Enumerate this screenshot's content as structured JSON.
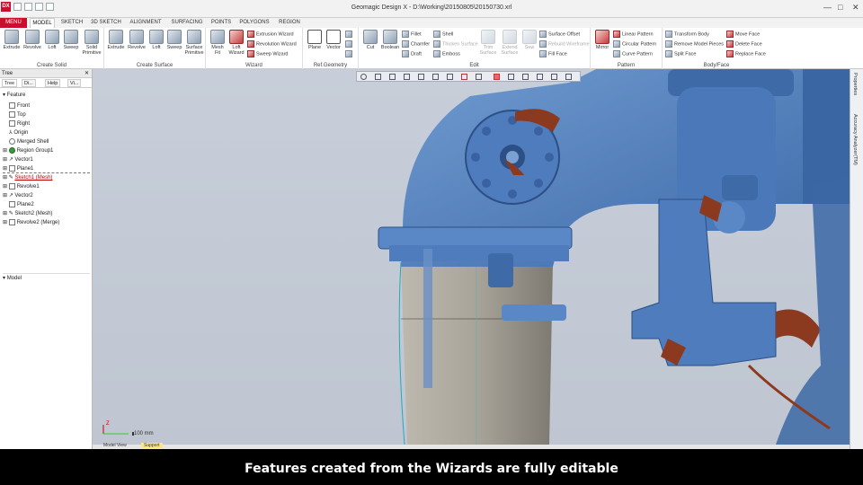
{
  "app": {
    "logo": "DX",
    "title": "Geomagic Design X - D:\\Working\\20150805\\20150730.xrl"
  },
  "window_controls": [
    "—",
    "□",
    "✕"
  ],
  "tabs": [
    {
      "label": "MENU"
    },
    {
      "label": "MODEL"
    },
    {
      "label": "SKETCH"
    },
    {
      "label": "3D SKETCH"
    },
    {
      "label": "ALIGNMENT"
    },
    {
      "label": "SURFACING"
    },
    {
      "label": "POINTS"
    },
    {
      "label": "POLYGONS"
    },
    {
      "label": "REGION"
    }
  ],
  "ribbon": {
    "create_solid": {
      "caption": "Create Solid",
      "buttons": [
        "Extrude",
        "Revolve",
        "Loft",
        "Sweep",
        "Solid Primitive"
      ]
    },
    "create_surface": {
      "caption": "Create Surface",
      "buttons": [
        "Extrude",
        "Revolve",
        "Loft",
        "Sweep",
        "Surface Primitive"
      ]
    },
    "wizard": {
      "caption": "Wizard",
      "buttons": [
        "Mesh Fit",
        "Loft Wizard"
      ],
      "small": [
        "Extrusion Wizard",
        "Revolution Wizard",
        "Sweep Wizard"
      ]
    },
    "ref_geometry": {
      "caption": "Ref.Geometry",
      "buttons": [
        "Plane",
        "Vector"
      ]
    },
    "edit": {
      "caption": "Edit",
      "buttons": [
        "Cut",
        "Boolean"
      ],
      "small": [
        "Fillet",
        "Chamfer",
        "Draft",
        "Shell",
        "Thicken Surface",
        "Emboss",
        "Trim Surface",
        "Extend Surface",
        "Sew",
        "Surface Offset",
        "Rebuild Wireframe",
        "Fill Face"
      ]
    },
    "pattern": {
      "caption": "Pattern",
      "buttons": [
        "Mirror"
      ],
      "small": [
        "Linear Pattern",
        "Circular Pattern",
        "Curve Pattern"
      ]
    },
    "body_face": {
      "caption": "Body/Face",
      "small": [
        "Transform Body",
        "Remove Model Pieces",
        "Split Face",
        "Move Face",
        "Delete Face",
        "Replace Face"
      ]
    }
  },
  "tree": {
    "header": "Tree",
    "tabs": [
      "Tree",
      "Di...",
      "Help",
      "Vi..."
    ],
    "section": "Feature",
    "items": [
      {
        "label": "Front"
      },
      {
        "label": "Top"
      },
      {
        "label": "Right"
      },
      {
        "label": "Origin"
      },
      {
        "label": "Merged Shell"
      },
      {
        "label": "Region Group1"
      },
      {
        "label": "Vector1"
      },
      {
        "label": "Plane1"
      },
      {
        "label": "Sketch1 (Mesh)"
      },
      {
        "label": "Revolve1"
      },
      {
        "label": "Vector2"
      },
      {
        "label": "Plane2"
      },
      {
        "label": "Sketch2 (Mesh)"
      },
      {
        "label": "Revolve2 (Merge)"
      }
    ],
    "model_section": "Model"
  },
  "viewport": {
    "scale_label": "100 mm",
    "axis_z": "Z"
  },
  "side_tabs": [
    "Properties",
    "Accuracy Analyzer(TM)"
  ],
  "bottom_tabs": [
    "Model View",
    "Support"
  ],
  "caption": "Features created from the Wizards are fully editable",
  "colors": {
    "scan_blue": "#4a7ab8",
    "deviation_brown": "#8b3a20",
    "cad_surface": "#a8a49a",
    "viewport_bg": "#c3cad5",
    "accent_red": "#c8102e"
  }
}
